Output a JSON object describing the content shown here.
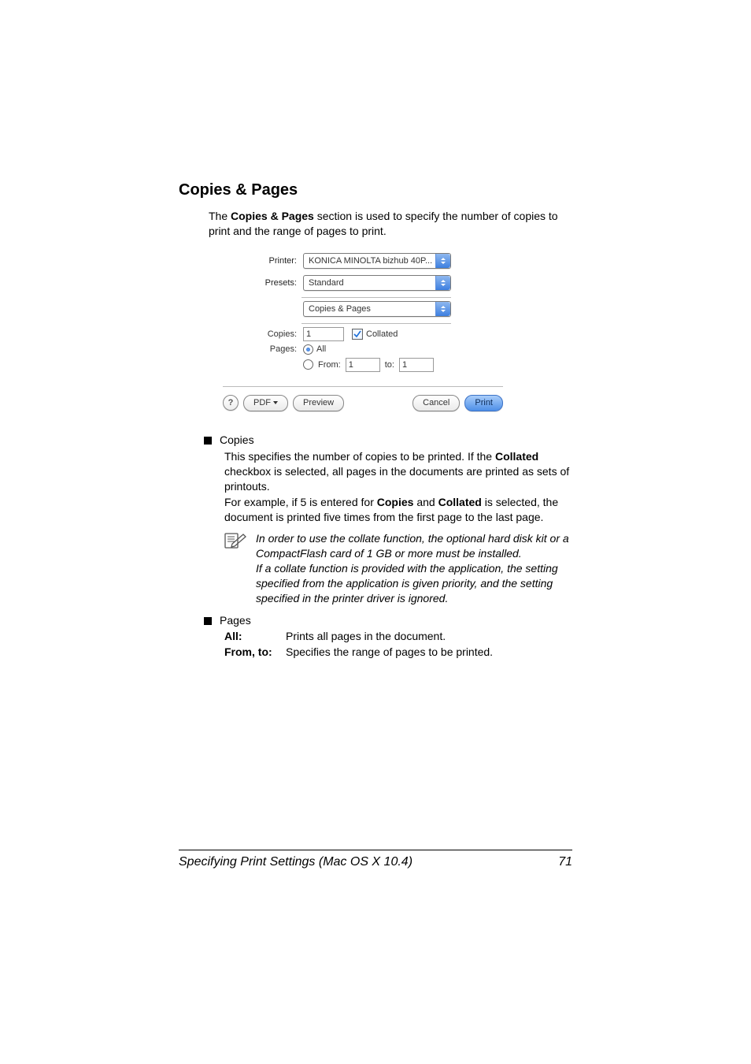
{
  "heading": "Copies & Pages",
  "intro_pre": "The ",
  "intro_bold": "Copies & Pages",
  "intro_post": " section is used to specify the number of copies to print and the range of pages to print.",
  "dialog": {
    "printer_label": "Printer:",
    "printer_value": "KONICA MINOLTA bizhub 40P...",
    "presets_label": "Presets:",
    "presets_value": "Standard",
    "pane_value": "Copies & Pages",
    "copies_label": "Copies:",
    "copies_value": "1",
    "collated_label": "Collated",
    "pages_label": "Pages:",
    "all_label": "All",
    "from_label": "From:",
    "from_value": "1",
    "to_label": "to:",
    "to_value": "1",
    "help_label": "?",
    "pdf_label": "PDF",
    "preview_label": "Preview",
    "cancel_label": "Cancel",
    "print_label": "Print"
  },
  "copies_bullet": "Copies",
  "copies_p1a": "This specifies the number of copies to be printed. If the ",
  "copies_p1b": "Collated",
  "copies_p1c": " checkbox is selected, all pages in the documents are printed as sets of printouts.",
  "copies_p2a": "For example, if 5 is entered for ",
  "copies_p2b": "Copies",
  "copies_p2c": " and ",
  "copies_p2d": "Collated",
  "copies_p2e": " is selected, the document is printed five times from the first page to the last page.",
  "note1": "In order to use the collate function, the optional hard disk kit or a CompactFlash card of 1 GB or more must be installed.",
  "note2": "If a collate function is provided with the application, the setting specified from the application is given priority, and the setting specified in the printer driver is ignored.",
  "pages_bullet": "Pages",
  "def_all_term": "All",
  "def_all_colon": ":",
  "def_all_desc": "Prints all pages in the document.",
  "def_fromto_term": "From, to",
  "def_fromto_colon": ":",
  "def_fromto_desc": "Specifies the range of pages to be printed.",
  "footer_left": "Specifying Print Settings (Mac OS X 10.4)",
  "footer_right": "71"
}
